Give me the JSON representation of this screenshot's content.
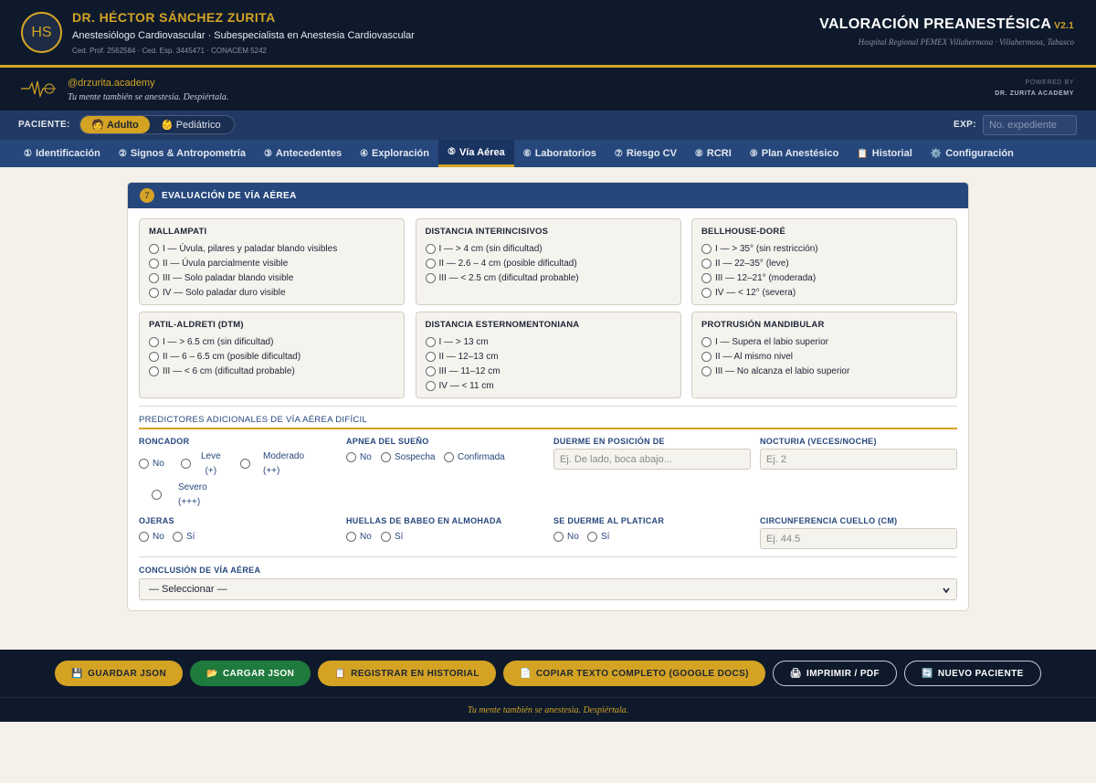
{
  "header": {
    "initials": "HS",
    "doctor_name": "DR. HÉCTOR SÁNCHEZ ZURITA",
    "specialty": "Anestesiólogo Cardiovascular · Subespecialista en Anestesia Cardiovascular",
    "credentials": "Ced. Prof. 2562584 · Ced. Esp. 3445471 · CONACEM 5242",
    "app_title": "VALORACIÓN PREANESTÉSICA",
    "version": "V2.1",
    "hospital": "Hospital Regional PEMEX Villahermosa · Villahermosa, Tabasco"
  },
  "brand": {
    "handle": "@drzurita.academy",
    "motto": "Tu mente también se anestesia. Despiértala.",
    "powered_by": "POWERED BY",
    "powered_name": "DR. ZURITA ACADEMY"
  },
  "patient": {
    "label": "PACIENTE:",
    "adult": "Adulto",
    "pediatric": "Pediátrico",
    "adult_icon": "adult-icon",
    "pediatric_icon": "child-icon",
    "exp_label": "EXP:",
    "exp_placeholder": "No. expediente"
  },
  "nav": {
    "tabs": [
      {
        "icon": "①",
        "label": "Identificación"
      },
      {
        "icon": "②",
        "label": "Signos & Antropometría"
      },
      {
        "icon": "③",
        "label": "Antecedentes"
      },
      {
        "icon": "④",
        "label": "Exploración"
      },
      {
        "icon": "⑤",
        "label": "Vía Aérea"
      },
      {
        "icon": "⑥",
        "label": "Laboratorios"
      },
      {
        "icon": "⑦",
        "label": "Riesgo CV"
      },
      {
        "icon": "⑧",
        "label": "RCRI"
      },
      {
        "icon": "⑨",
        "label": "Plan Anestésico"
      },
      {
        "icon": "📋",
        "label": "Historial"
      },
      {
        "icon": "⚙️",
        "label": "Configuración"
      }
    ],
    "active_index": 4
  },
  "section": {
    "number": "7",
    "title": "EVALUACIÓN DE VÍA AÉREA",
    "boxes": [
      {
        "title": "MALLAMPATI",
        "options": [
          "I — Úvula, pilares y paladar blando visibles",
          "II — Úvula parcialmente visible",
          "III — Solo paladar blando visible",
          "IV — Solo paladar duro visible"
        ]
      },
      {
        "title": "DISTANCIA INTERINCISIVOS",
        "options": [
          "I — > 4 cm (sin dificultad)",
          "II — 2.6 – 4 cm (posible dificultad)",
          "III — < 2.5 cm (dificultad probable)"
        ]
      },
      {
        "title": "BELLHOUSE-DORÉ",
        "options": [
          "I — > 35° (sin restricción)",
          "II — 22–35° (leve)",
          "III — 12–21° (moderada)",
          "IV — < 12° (severa)"
        ]
      },
      {
        "title": "PATIL-ALDRETI (DTM)",
        "options": [
          "I — > 6.5 cm (sin dificultad)",
          "II — 6 – 6.5 cm (posible dificultad)",
          "III — < 6 cm (dificultad probable)"
        ]
      },
      {
        "title": "DISTANCIA ESTERNOMENTONIANA",
        "options": [
          "I — > 13 cm",
          "II — 12–13 cm",
          "III — 11–12 cm",
          "IV — < 11 cm"
        ]
      },
      {
        "title": "PROTRUSIÓN MANDIBULAR",
        "options": [
          "I — Supera el labio superior",
          "II — Al mismo nivel",
          "III — No alcanza el labio superior"
        ]
      }
    ],
    "predictors_title": "PREDICTORES ADICIONALES DE VÍA AÉREA DIFÍCIL",
    "roncador": {
      "label": "RONCADOR",
      "no": "No",
      "leve": "Leve",
      "leve_sub": "(+)",
      "moderado": "Moderado",
      "moderado_sub": "(++)",
      "severo": "Severo",
      "severo_sub": "(+++)"
    },
    "apnea": {
      "label": "APNEA DEL SUEÑO",
      "options": [
        "No",
        "Sospecha",
        "Confirmada"
      ]
    },
    "duerme": {
      "label": "DUERME EN POSICIÓN DE",
      "placeholder": "Ej. De lado, boca abajo..."
    },
    "nocturia": {
      "label": "NOCTURIA (VECES/NOCHE)",
      "placeholder": "Ej. 2"
    },
    "ojeras": {
      "label": "OJERAS",
      "options": [
        "No",
        "Sí"
      ]
    },
    "huellas": {
      "label": "HUELLAS DE BABEO EN ALMOHADA",
      "options": [
        "No",
        "Sí"
      ]
    },
    "platicar": {
      "label": "SE DUERME AL PLATICAR",
      "options": [
        "No",
        "Sí"
      ]
    },
    "cuello": {
      "label": "CIRCUNFERENCIA CUELLO (CM)",
      "placeholder": "Ej. 44.5"
    },
    "conclusion": {
      "label": "CONCLUSIÓN DE VÍA AÉREA",
      "selected": "— Seleccionar —"
    }
  },
  "footer": {
    "buttons": [
      {
        "icon": "💾",
        "label": "GUARDAR JSON",
        "style": "gold"
      },
      {
        "icon": "📂",
        "label": "CARGAR JSON",
        "style": "green"
      },
      {
        "icon": "📋",
        "label": "REGISTRAR EN HISTORIAL",
        "style": "gold"
      },
      {
        "icon": "📄",
        "label": "COPIAR TEXTO COMPLETO (GOOGLE DOCS)",
        "style": "gold"
      },
      {
        "icon": "🖨",
        "label": "IMPRIMIR / PDF",
        "style": "outline"
      },
      {
        "icon": "🔄",
        "label": "NUEVO PACIENTE",
        "style": "outline"
      }
    ],
    "motto": "Tu mente también se anestesia. Despiértala."
  },
  "colors": {
    "navy": "#0e1a2c",
    "blue": "#26477c",
    "gold": "#d4a324",
    "green": "#1f7a3d",
    "background": "#f4f1ea"
  }
}
